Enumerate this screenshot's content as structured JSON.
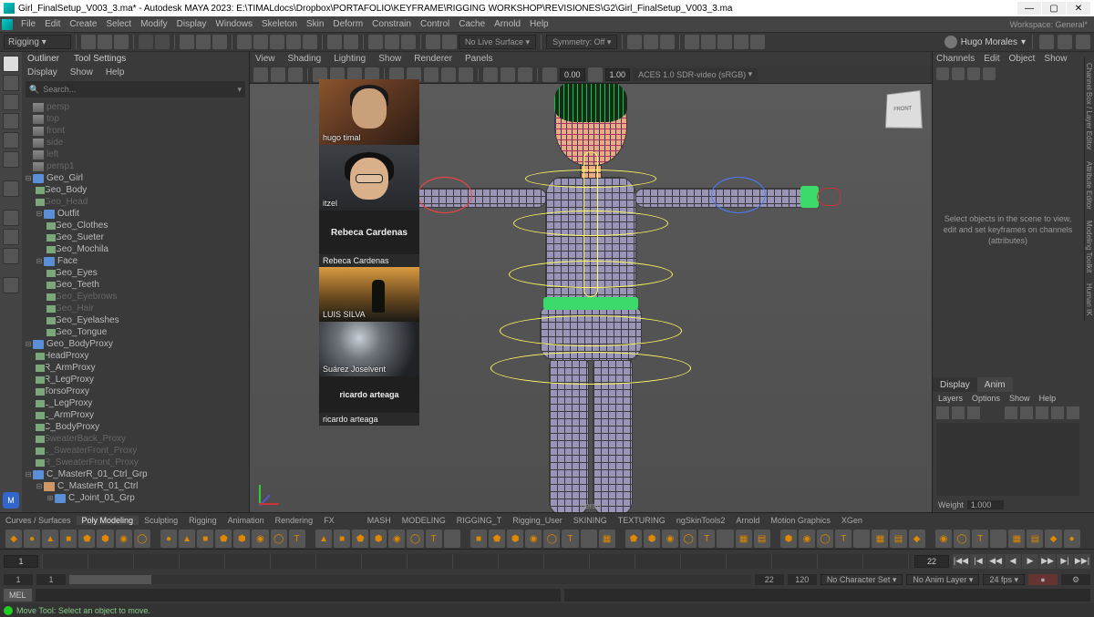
{
  "window": {
    "title": "Girl_FinalSetup_V003_3.ma* - Autodesk MAYA 2023: E:\\TIMALdocs\\Dropbox\\PORTAFOLIO\\KEYFRAME\\RIGGING WORKSHOP\\REVISIONES\\G2\\Girl_FinalSetup_V003_3.ma",
    "min": "—",
    "max": "▢",
    "close": "✕"
  },
  "menubar": {
    "items": [
      "File",
      "Edit",
      "Create",
      "Select",
      "Modify",
      "Display",
      "Windows",
      "Skeleton",
      "Skin",
      "Deform",
      "Constrain",
      "Control",
      "Cache",
      "Arnold",
      "Help"
    ],
    "workspace": "Workspace: General*"
  },
  "shelf": {
    "module": "Rigging",
    "noLiveSurface": "No Live Surface",
    "symmetry": "Symmetry: Off",
    "user": "Hugo Morales"
  },
  "outliner": {
    "header": [
      "Outliner",
      "Tool Settings"
    ],
    "menu": [
      "Display",
      "Show",
      "Help"
    ],
    "searchPlaceholder": "Search...",
    "nodes": [
      {
        "t": "persp",
        "dim": true,
        "ico": "cam",
        "i": 0
      },
      {
        "t": "top",
        "dim": true,
        "ico": "cam",
        "i": 0
      },
      {
        "t": "front",
        "dim": true,
        "ico": "cam",
        "i": 0
      },
      {
        "t": "side",
        "dim": true,
        "ico": "cam",
        "i": 0
      },
      {
        "t": "left",
        "dim": true,
        "ico": "cam",
        "i": 0
      },
      {
        "t": "persp1",
        "dim": true,
        "ico": "cam",
        "i": 0
      },
      {
        "t": "Geo_Girl",
        "ico": "grp",
        "i": 0,
        "exp": "⊟"
      },
      {
        "t": "Geo_Body",
        "ico": "mesh",
        "i": 1,
        "exp": "⊞"
      },
      {
        "t": "Geo_Head",
        "dim": true,
        "ico": "mesh",
        "i": 1,
        "exp": "⊞"
      },
      {
        "t": "Outfit",
        "ico": "grp",
        "i": 1,
        "exp": "⊟"
      },
      {
        "t": "Geo_Clothes",
        "ico": "mesh",
        "i": 2,
        "exp": "⊞"
      },
      {
        "t": "Geo_Sueter",
        "ico": "mesh",
        "i": 2,
        "exp": "⊞"
      },
      {
        "t": "Geo_Mochila",
        "ico": "mesh",
        "i": 2,
        "exp": "⊞"
      },
      {
        "t": "Face",
        "ico": "grp",
        "i": 1,
        "exp": "⊟"
      },
      {
        "t": "Geo_Eyes",
        "ico": "mesh",
        "i": 2,
        "exp": "⊞"
      },
      {
        "t": "Geo_Teeth",
        "ico": "mesh",
        "i": 2,
        "exp": "⊞"
      },
      {
        "t": "Geo_Eyebrows",
        "dim": true,
        "ico": "mesh",
        "i": 2,
        "exp": "⊞"
      },
      {
        "t": "Geo_Hair",
        "dim": true,
        "ico": "mesh",
        "i": 2,
        "exp": "⊞"
      },
      {
        "t": "Geo_Eyelashes",
        "ico": "mesh",
        "i": 2,
        "exp": "⊞"
      },
      {
        "t": "Geo_Tongue",
        "ico": "mesh",
        "i": 2,
        "exp": "⊞"
      },
      {
        "t": "Geo_BodyProxy",
        "ico": "grp",
        "i": 0,
        "exp": "⊟"
      },
      {
        "t": "HeadProxy",
        "ico": "mesh",
        "i": 1,
        "exp": "⊞"
      },
      {
        "t": "R_ArmProxy",
        "ico": "mesh",
        "i": 1,
        "exp": "⊞"
      },
      {
        "t": "R_LegProxy",
        "ico": "mesh",
        "i": 1,
        "exp": "⊞"
      },
      {
        "t": "TorsoProxy",
        "ico": "mesh",
        "i": 1,
        "exp": "⊞"
      },
      {
        "t": "L_LegProxy",
        "ico": "mesh",
        "i": 1,
        "exp": "⊞"
      },
      {
        "t": "L_ArmProxy",
        "ico": "mesh",
        "i": 1,
        "exp": "⊞"
      },
      {
        "t": "C_BodyProxy",
        "ico": "mesh",
        "i": 1,
        "exp": "⊞"
      },
      {
        "t": "SweaterBack_Proxy",
        "dim": true,
        "ico": "mesh",
        "i": 1,
        "exp": "⊞"
      },
      {
        "t": "L_SweaterFront_Proxy",
        "dim": true,
        "ico": "mesh",
        "i": 1,
        "exp": "⊞"
      },
      {
        "t": "R_SweaterFront_Proxy",
        "dim": true,
        "ico": "mesh",
        "i": 1,
        "exp": "⊞"
      },
      {
        "t": "C_MasterR_01_Ctrl_Grp",
        "ico": "grp",
        "i": 0,
        "exp": "⊟"
      },
      {
        "t": "C_MasterR_01_Ctrl",
        "ico": "crv",
        "i": 1,
        "exp": "⊟"
      },
      {
        "t": "C_Joint_01_Grp",
        "ico": "grp",
        "i": 2,
        "exp": "⊞"
      }
    ]
  },
  "viewport": {
    "menu": [
      "View",
      "Shading",
      "Lighting",
      "Show",
      "Renderer",
      "Panels"
    ],
    "frameField": "0.00",
    "exposure": "1.00",
    "colorspace": "ACES 1.0 SDR-video (sRGB)",
    "cameraLabel": "persp",
    "viewcube": "FRONT"
  },
  "rightpanel": {
    "menu": [
      "Channels",
      "Edit",
      "Object",
      "Show"
    ],
    "hint": "Select objects in the scene to view, edit and set keyframes on channels (attributes)",
    "tabs": {
      "display": "Display",
      "anim": "Anim"
    },
    "layermenu": [
      "Layers",
      "Options",
      "Show",
      "Help"
    ],
    "weight": {
      "label": "Weight",
      "value": "1.000"
    }
  },
  "vtabs": [
    "Channel Box / Layer Editor",
    "Attribute Editor",
    "Modeling Toolkit",
    "Human IK"
  ],
  "shelves": {
    "tabs": [
      "Curves / Surfaces",
      "Poly Modeling",
      "Sculpting",
      "Rigging",
      "Animation",
      "Rendering",
      "FX",
      "",
      "",
      "MASH",
      "MODELING",
      "RIGGING_T",
      "Rigging_User",
      "SKINING",
      "TEXTURING",
      "ngSkinTools2",
      "Arnold",
      "Motion Graphics",
      "XGen"
    ],
    "activeTab": 1
  },
  "timeline": {
    "start": "1",
    "end": "22",
    "playbackControls": [
      "|◀◀",
      "|◀",
      "◀◀",
      "◀",
      "▶",
      "▶▶",
      "▶|",
      "▶▶|"
    ]
  },
  "range": {
    "start": "1",
    "end": "120",
    "dispStart": "1",
    "dispEnd": "22",
    "charset": "No Character Set",
    "animlayer": "No Anim Layer",
    "fps": "24 fps"
  },
  "cmd": {
    "lang": "MEL"
  },
  "status": {
    "text": "Move Tool: Select an object to move."
  },
  "videochat": {
    "p1": "hugo timal",
    "p2": "itzel",
    "p3": "Rebeca Cardenas",
    "p3b": "Rebeca Cardenas",
    "p4": "LUIS SILVA",
    "p5": "Suárez Joselvent",
    "p6": "ricardo arteaga",
    "p6b": "ricardo arteaga"
  }
}
